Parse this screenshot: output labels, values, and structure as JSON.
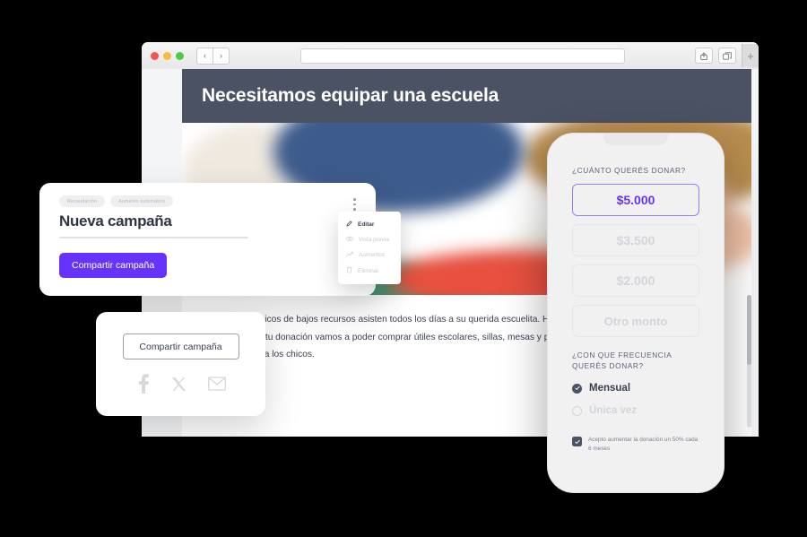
{
  "browser": {
    "traffic_lights": [
      "close",
      "minimize",
      "maximize"
    ],
    "back_label": "‹",
    "forward_label": "›",
    "address_value": "",
    "address_placeholder": "",
    "share_icon": "share-icon",
    "tabs_icon": "tabs-icon",
    "new_tab_label": "+"
  },
  "page": {
    "hero_title": "Necesitamos equipar una escuela",
    "body_paragraph": "Cientos de chicos de bajos recursos asisten todos los días a su querida escuelita. Hoy no pueden tener todo lo necesario para estudiar.  Con tu donación vamos a poder comprar útiles escolares, sillas, mesas y pizarrones. Una pequeña donación marca la diferencia para los chicos."
  },
  "campaign_card": {
    "tags": [
      "Recaudación",
      "Aumento automático"
    ],
    "title": "Nueva campaña",
    "share_button": "Compartir campaña",
    "kebab_icon": "more-vertical-icon"
  },
  "context_menu": {
    "items": [
      {
        "label": "Editar",
        "icon": "pencil-icon",
        "active": true
      },
      {
        "label": "Vista previa",
        "icon": "eye-icon",
        "active": false
      },
      {
        "label": "Aumentos",
        "icon": "trending-up-icon",
        "active": false
      },
      {
        "label": "Eliminar",
        "icon": "trash-icon",
        "active": false
      }
    ]
  },
  "share_card": {
    "button_label": "Compartir campaña",
    "socials": [
      {
        "name": "facebook-icon"
      },
      {
        "name": "x-twitter-icon"
      },
      {
        "name": "email-icon"
      }
    ]
  },
  "phone": {
    "amount_label": "¿Cuánto querés donar?",
    "amounts": [
      {
        "value": "$5.000",
        "selected": true
      },
      {
        "value": "$3.500",
        "selected": false
      },
      {
        "value": "$2.000",
        "selected": false
      },
      {
        "value": "Otro monto",
        "selected": false
      }
    ],
    "frequency_label": "¿Con que frecuencia querés donar?",
    "frequency_options": [
      {
        "label": "Mensual",
        "selected": true
      },
      {
        "label": "Única vez",
        "selected": false
      }
    ],
    "consent_text": "Acepto aumentar la donación un 50% cada 6 meses",
    "consent_checked": true
  },
  "colors": {
    "accent_purple": "#6633fa",
    "hero_bar": "#4a5263",
    "page_bg": "#f4f5f6",
    "backdrop": "#000000"
  }
}
